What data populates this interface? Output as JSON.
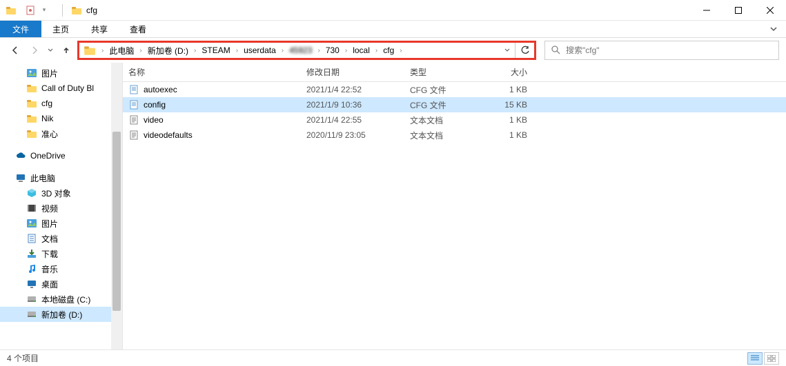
{
  "titlebar": {
    "title": "cfg"
  },
  "ribbon": {
    "file": "文件",
    "tabs": [
      "主页",
      "共享",
      "查看"
    ]
  },
  "breadcrumbs": [
    {
      "label": "此电脑",
      "blur": false
    },
    {
      "label": "新加卷 (D:)",
      "blur": false
    },
    {
      "label": "STEAM",
      "blur": false
    },
    {
      "label": "userdata",
      "blur": false
    },
    {
      "label": "45923",
      "blur": true
    },
    {
      "label": "730",
      "blur": false
    },
    {
      "label": "local",
      "blur": false
    },
    {
      "label": "cfg",
      "blur": false
    }
  ],
  "search": {
    "placeholder": "搜索\"cfg\""
  },
  "sidebar": {
    "items": [
      {
        "label": "图片",
        "icon": "picture",
        "level": 1
      },
      {
        "label": "Call of Duty  Bl",
        "icon": "folder",
        "level": 1
      },
      {
        "label": "cfg",
        "icon": "folder",
        "level": 1
      },
      {
        "label": "Nik",
        "icon": "folder",
        "level": 1
      },
      {
        "label": "准心",
        "icon": "folder",
        "level": 1
      },
      {
        "label": "OneDrive",
        "icon": "cloud",
        "level": 0,
        "gap": true
      },
      {
        "label": "此电脑",
        "icon": "pc",
        "level": 0,
        "gap": true
      },
      {
        "label": "3D 对象",
        "icon": "3d",
        "level": 1
      },
      {
        "label": "视频",
        "icon": "video",
        "level": 1
      },
      {
        "label": "图片",
        "icon": "picture",
        "level": 1
      },
      {
        "label": "文档",
        "icon": "doc",
        "level": 1
      },
      {
        "label": "下载",
        "icon": "download",
        "level": 1
      },
      {
        "label": "音乐",
        "icon": "music",
        "level": 1
      },
      {
        "label": "桌面",
        "icon": "desktop",
        "level": 1
      },
      {
        "label": "本地磁盘 (C:)",
        "icon": "disk",
        "level": 1
      },
      {
        "label": "新加卷 (D:)",
        "icon": "disk",
        "level": 1,
        "selected": true
      }
    ]
  },
  "columns": {
    "name": "名称",
    "date": "修改日期",
    "type": "类型",
    "size": "大小"
  },
  "files": [
    {
      "name": "autoexec",
      "date": "2021/1/4 22:52",
      "type": "CFG 文件",
      "size": "1 KB",
      "icon": "cfg",
      "selected": false
    },
    {
      "name": "config",
      "date": "2021/1/9 10:36",
      "type": "CFG 文件",
      "size": "15 KB",
      "icon": "cfg",
      "selected": true
    },
    {
      "name": "video",
      "date": "2021/1/4 22:55",
      "type": "文本文档",
      "size": "1 KB",
      "icon": "txt",
      "selected": false
    },
    {
      "name": "videodefaults",
      "date": "2020/11/9 23:05",
      "type": "文本文档",
      "size": "1 KB",
      "icon": "txt",
      "selected": false
    }
  ],
  "status": {
    "text": "4 个项目"
  }
}
